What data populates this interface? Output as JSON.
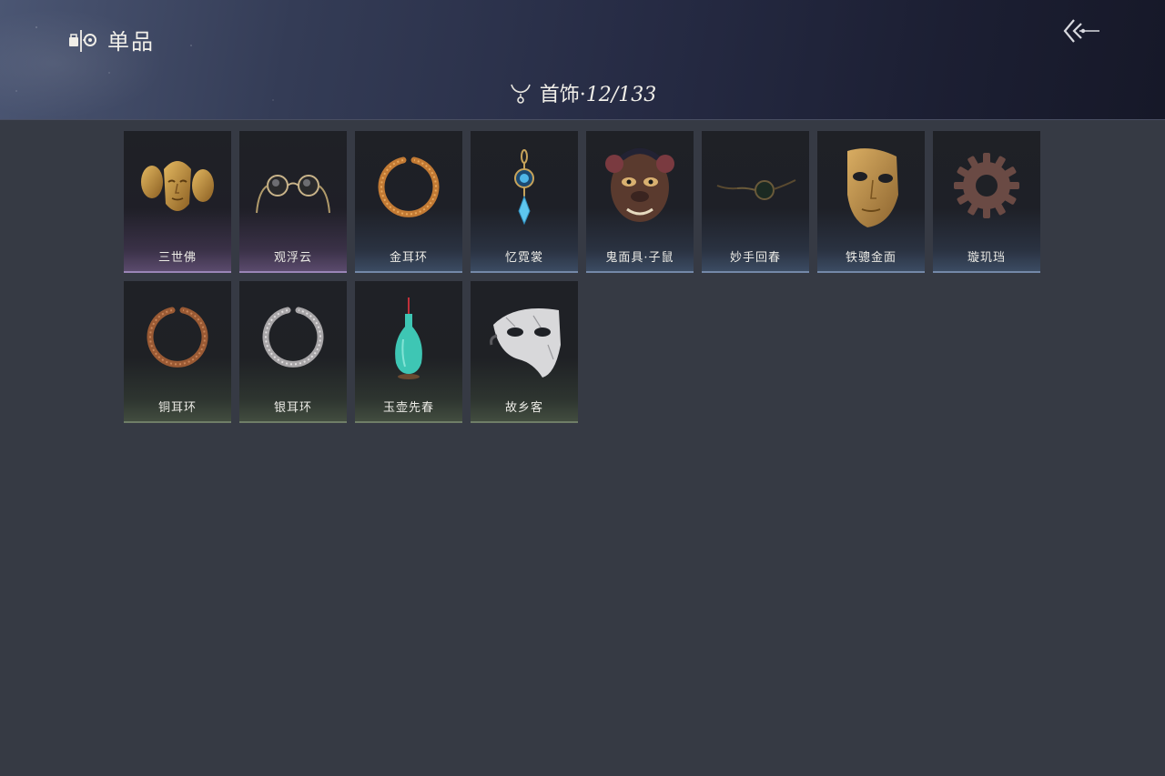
{
  "header": {
    "title": "单品",
    "category_name": "首饰",
    "category_separator": "·",
    "collected": "12/133"
  },
  "items": [
    {
      "name": "三世佛",
      "icon": "three-face-buddha-mask-icon",
      "rarity": "purple"
    },
    {
      "name": "观浮云",
      "icon": "round-spectacles-icon",
      "rarity": "purple"
    },
    {
      "name": "金耳环",
      "icon": "gold-earring-icon",
      "rarity": "blue"
    },
    {
      "name": "忆霓裳",
      "icon": "blue-gem-pendant-icon",
      "rarity": "blue"
    },
    {
      "name": "鬼面具·子鼠",
      "icon": "rat-demon-mask-icon",
      "rarity": "blue"
    },
    {
      "name": "妙手回春",
      "icon": "dark-glasses-icon",
      "rarity": "blue"
    },
    {
      "name": "铁骢金面",
      "icon": "golden-face-mask-icon",
      "rarity": "blue"
    },
    {
      "name": "璇玑珰",
      "icon": "gear-ring-icon",
      "rarity": "blue"
    },
    {
      "name": "铜耳环",
      "icon": "copper-earring-icon",
      "rarity": "green"
    },
    {
      "name": "银耳环",
      "icon": "silver-earring-icon",
      "rarity": "green"
    },
    {
      "name": "玉壶先春",
      "icon": "jade-vase-icon",
      "rarity": "green"
    },
    {
      "name": "故乡客",
      "icon": "white-half-mask-icon",
      "rarity": "green"
    }
  ],
  "colors": {
    "background": "#363a44",
    "purple_rarity": "#9a85b6",
    "blue_rarity": "#7488a8",
    "green_rarity": "#6f7d67"
  }
}
